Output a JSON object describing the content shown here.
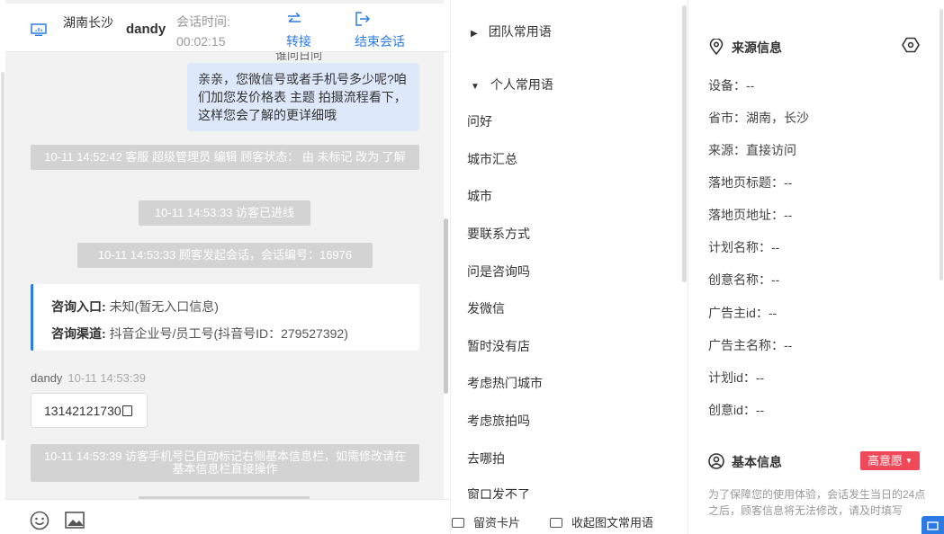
{
  "header": {
    "location": "湖南长沙",
    "agent": "dandy",
    "session_time_label": "会话时间:",
    "session_time": "00:02:15",
    "transfer_label": "转接",
    "end_label": "结束会话"
  },
  "chat": {
    "clipped_text": "谁问日问",
    "agent_bubble": "亲亲，您微信号或者手机号多少呢?咱们加您发价格表 主题 拍摄流程看下，这样您会了解的更详细哦",
    "system_messages": [
      "10-11 14:52:42 客服 超级管理员 编辑 顾客状态： 由 未标记 改为 了解",
      "10-11 14:53:33 访客已进线",
      "10-11 14:53:33 顾客发起会话，会话编号：16976"
    ],
    "entry": {
      "entry_label": "咨询入口:",
      "entry_value": "未知(暂无入口信息)",
      "channel_label": "咨询渠道:",
      "channel_value": "抖音企业号/员工号(抖音号ID：279527392)"
    },
    "visitor_name": "dandy",
    "visitor_time": "10-11 14:53:39",
    "phone": "13142121730",
    "auto_mark_msg": "10-11 14:53:39 访客手机号已自动标记右侧基本信息栏，如需修改请在基本信息栏直接操作"
  },
  "phrases": {
    "team_group": "团队常用语",
    "personal_group": "个人常用语",
    "items": [
      "问好",
      "城市汇总",
      "城市",
      "要联系方式",
      "问是咨询吗",
      "发微信",
      "暂时没有店",
      "考虑热门城市",
      "考虑旅拍吗",
      "去哪拍",
      "窗口发不了"
    ],
    "footer_card": "留资卡片",
    "footer_collect": "收起图文常用语"
  },
  "info": {
    "source_title": "来源信息",
    "rows": [
      "设备：--",
      "省市：湖南，长沙",
      "来源：直接访问",
      "落地页标题：--",
      "落地页地址：--",
      "计划名称：--",
      "创意名称：--",
      "广告主id：--",
      "广告主名称：--",
      "计划id：--",
      "创意id：--"
    ],
    "basic_title": "基本信息",
    "intent_badge": "高意愿",
    "note": "为了保障您的使用体验，会话发生当日的24点之后，顾客信息将无法修改，请及时填写"
  },
  "colors": {
    "accent": "#2c7be5",
    "badge": "#f04a5a",
    "system_bg": "#d3d3d3",
    "bubble": "#dde8fb"
  }
}
